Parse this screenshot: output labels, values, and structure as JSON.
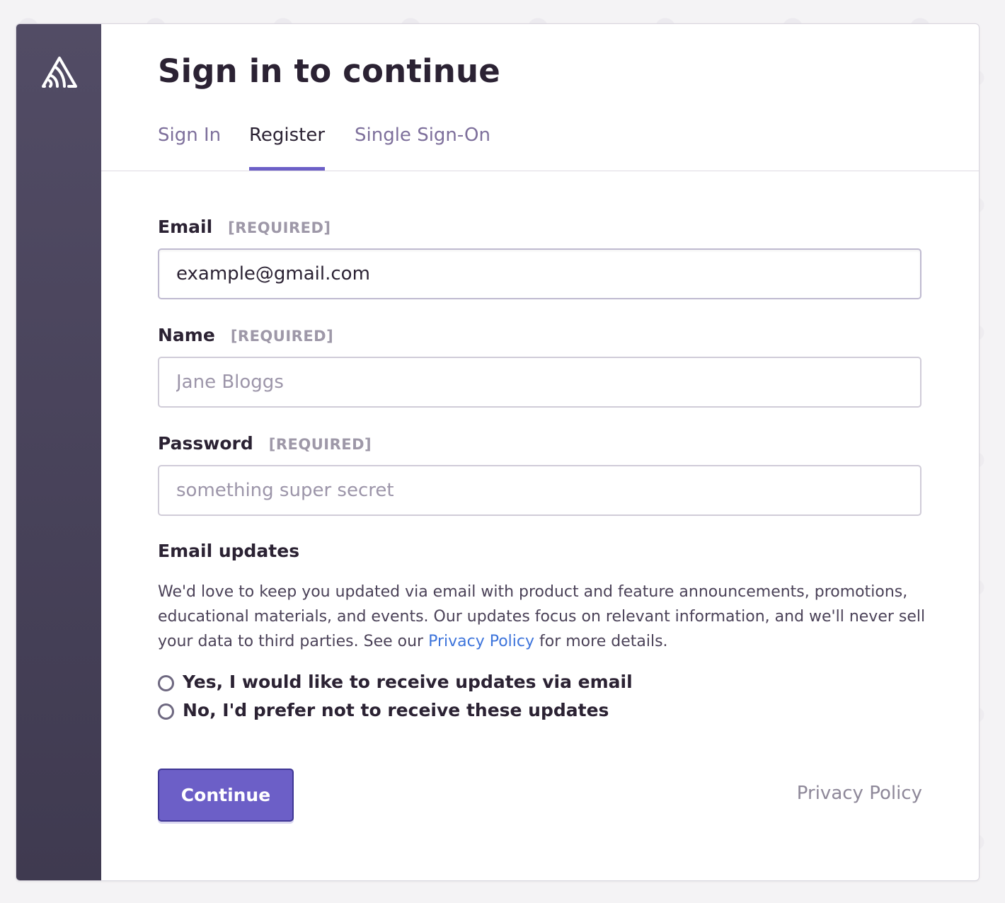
{
  "page": {
    "title": "Sign in to continue"
  },
  "tabs": [
    {
      "label": "Sign In",
      "active": false
    },
    {
      "label": "Register",
      "active": true
    },
    {
      "label": "Single Sign-On",
      "active": false
    }
  ],
  "form": {
    "required_tag": "[REQUIRED]",
    "email": {
      "label": "Email",
      "value": "example@gmail.com",
      "placeholder": ""
    },
    "name": {
      "label": "Name",
      "value": "",
      "placeholder": "Jane Bloggs"
    },
    "password": {
      "label": "Password",
      "value": "",
      "placeholder": "something super secret"
    }
  },
  "email_updates": {
    "title": "Email updates",
    "description_before_link": "We'd love to keep you updated via email with product and feature announcements, promotions, educational materials, and events. Our updates focus on relevant information, and we'll never sell your data to third parties. See our ",
    "link_text": "Privacy Policy",
    "description_after_link": " for more details.",
    "options": [
      {
        "label": "Yes, I would like to receive updates via email",
        "selected": false
      },
      {
        "label": "No, I'd prefer not to receive these updates",
        "selected": false
      }
    ]
  },
  "footer": {
    "continue_label": "Continue",
    "privacy_label": "Privacy Policy"
  },
  "colors": {
    "accent": "#6c5fc7",
    "sidebar": "#4a4459",
    "link": "#3d74db"
  },
  "icons": {
    "logo": "sentry-logo-icon"
  }
}
